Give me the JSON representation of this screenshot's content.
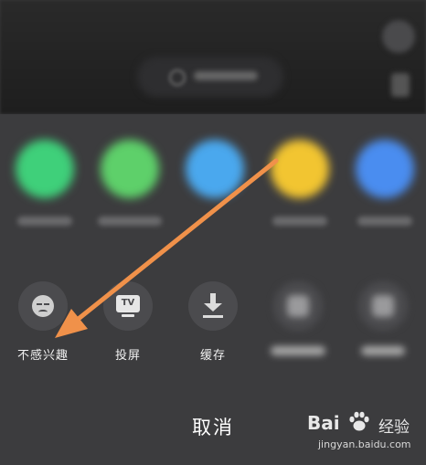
{
  "actions": {
    "not_interested": "不感兴趣",
    "cast_screen": "投屏",
    "cast_icon_text": "TV",
    "cache": "缓存"
  },
  "share_targets": [
    {
      "color": "#3fd07a"
    },
    {
      "color": "#5ed06a"
    },
    {
      "color": "#4aa8ee"
    },
    {
      "color": "#f2c531"
    },
    {
      "color": "#4a8df0"
    }
  ],
  "cancel_label": "取消",
  "watermark": {
    "brand": "Bai",
    "brand_suffix": "经验",
    "url": "jingyan.baidu.com"
  },
  "colors": {
    "arrow": "#f0914a",
    "sheet": "#3c3c3e"
  }
}
